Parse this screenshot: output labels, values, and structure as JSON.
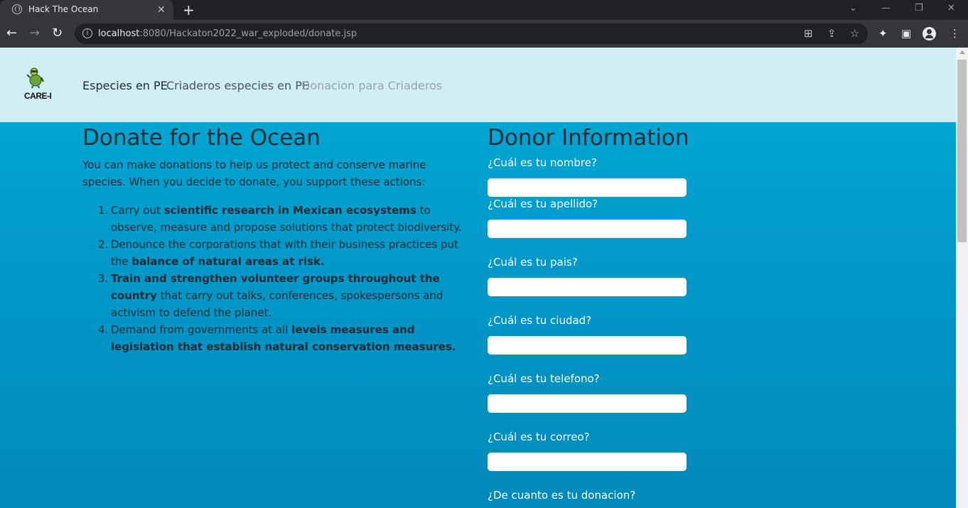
{
  "browser": {
    "tab_title": "Hack The Ocean",
    "tab_close": "✕",
    "new_tab": "+",
    "url_host": "localhost",
    "url_rest": ":8080/Hackaton2022_war_exploded/donate.jsp",
    "window_controls": {
      "menu": "⌄",
      "minimize": "—",
      "restore": "❐",
      "close": "✕"
    }
  },
  "site": {
    "logo_text": "CARE-I",
    "nav": [
      {
        "label": "Especies en PE",
        "color": "#1f2a33"
      },
      {
        "label": "Criaderos especies en PE",
        "color": "#4a5560"
      },
      {
        "label": "Donacion para Criaderos",
        "color": "#97a3ab"
      }
    ]
  },
  "left": {
    "title": "Donate for the Ocean",
    "intro": "You can make donations to help us protect and conserve marine species. When you decide to donate, you support these actions:",
    "actions": [
      {
        "num": "1.",
        "before": "Carry out ",
        "bold": "scientific research in Mexican ecosystems",
        "after": " to observe, measure and propose solutions that protect biodiversity."
      },
      {
        "num": "2.",
        "before": "Denounce the corporations that with their business practices put the ",
        "bold": "balance of natural areas at risk.",
        "after": ""
      },
      {
        "num": "3.",
        "before": "",
        "bold": "Train and strengthen volunteer groups throughout the country",
        "after": " that carry out talks, conferences, spokespersons and activism to defend the planet."
      },
      {
        "num": "4.",
        "before": "Demand from governments at all ",
        "bold": "levels measures and legislation that establish natural conservation measures.",
        "after": ""
      }
    ]
  },
  "right": {
    "title": "Donor Information",
    "fields": [
      {
        "label": "¿Cuál es tu nombre?",
        "value": ""
      },
      {
        "label": "¿Cuál es tu apellido?",
        "value": ""
      },
      {
        "label": "¿Cuál es tu pais?",
        "value": ""
      },
      {
        "label": "¿Cuál es tu ciudad?",
        "value": ""
      },
      {
        "label": "¿Cuál es tu telefono?",
        "value": ""
      },
      {
        "label": "¿Cuál es tu correo?",
        "value": ""
      },
      {
        "label": "¿De cuanto es tu donacion?",
        "value": ""
      }
    ]
  }
}
